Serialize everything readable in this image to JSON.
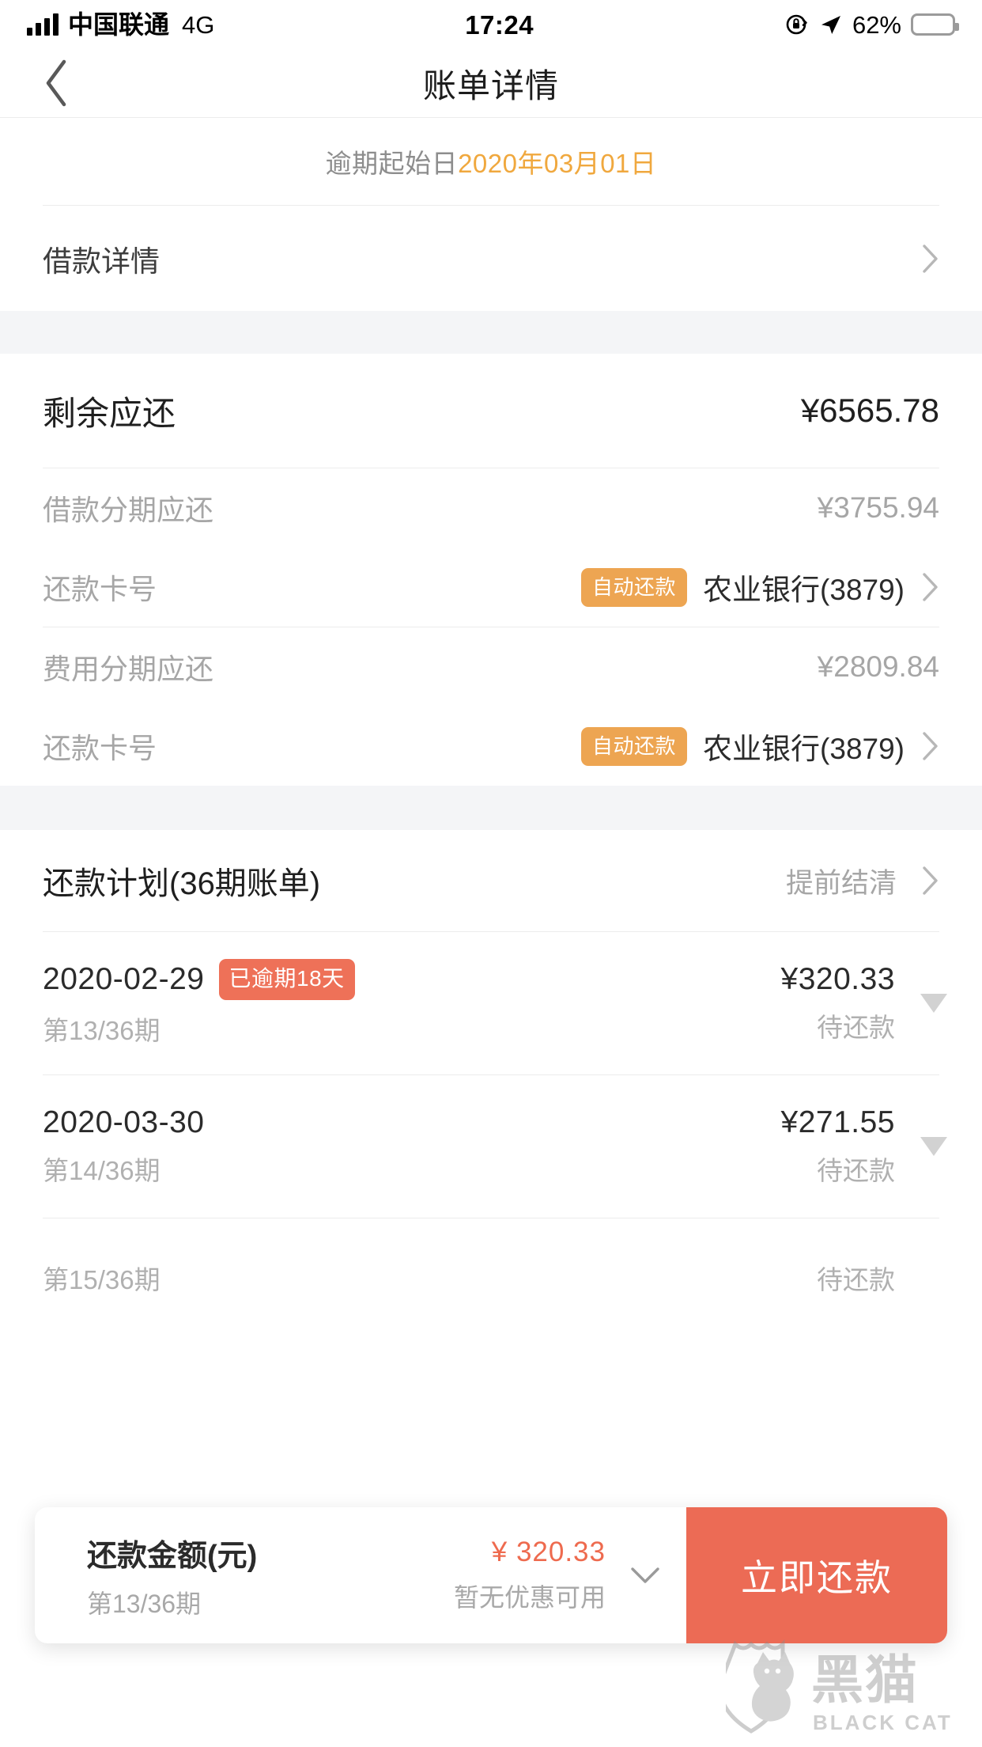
{
  "statusbar": {
    "carrier": "中国联通",
    "network": "4G",
    "time": "17:24",
    "battery_percent": "62%",
    "signal_icon": "signal-bars-icon",
    "lock_icon": "rotation-lock-icon",
    "location_icon": "location-arrow-icon",
    "battery_icon": "battery-icon"
  },
  "navbar": {
    "title": "账单详情",
    "back_icon": "chevron-left-icon"
  },
  "overdue": {
    "label": "逾期起始日",
    "date": "2020年03月01日"
  },
  "loan_detail_row": {
    "label": "借款详情",
    "chevron_icon": "chevron-right-icon"
  },
  "summary": {
    "remaining": {
      "label": "剩余应还",
      "value": "¥6565.78"
    },
    "principal": {
      "label": "借款分期应还",
      "value": "¥3755.94"
    },
    "principal_card": {
      "label": "还款卡号",
      "badge": "自动还款",
      "value": "农业银行(3879)",
      "chevron_icon": "chevron-right-icon"
    },
    "fee": {
      "label": "费用分期应还",
      "value": "¥2809.84"
    },
    "fee_card": {
      "label": "还款卡号",
      "badge": "自动还款",
      "value": "农业银行(3879)",
      "chevron_icon": "chevron-right-icon"
    }
  },
  "plan": {
    "title": "还款计划(36期账单)",
    "settle_link": "提前结清",
    "chevron_icon": "chevron-right-icon",
    "installments": [
      {
        "date": "2020-02-29",
        "badge": "已逾期18天",
        "amount": "¥320.33",
        "term": "第13/36期",
        "status": "待还款",
        "expand_icon": "triangle-down-icon"
      },
      {
        "date": "2020-03-30",
        "badge": "",
        "amount": "¥271.55",
        "term": "第14/36期",
        "status": "待还款",
        "expand_icon": "triangle-down-icon"
      },
      {
        "date": "",
        "badge": "",
        "amount": "",
        "term": "第15/36期",
        "status": "待还款",
        "expand_icon": "triangle-down-icon"
      }
    ]
  },
  "paybar": {
    "amount_title": "还款金额(元)",
    "term": "第13/36期",
    "price": "¥ 320.33",
    "promo": "暂无优惠可用",
    "caret_icon": "chevron-down-icon",
    "button_label": "立即还款"
  },
  "watermark": {
    "cn": "黑猫",
    "en": "BLACK CAT",
    "icon": "black-cat-shield-icon"
  },
  "colors": {
    "accent_orange": "#eda552",
    "accent_red": "#ec6b55",
    "badge_overdue": "#ee7158",
    "date_orange": "#f0a83e",
    "divider": "#ececec",
    "section_gap": "#f4f5f7"
  }
}
